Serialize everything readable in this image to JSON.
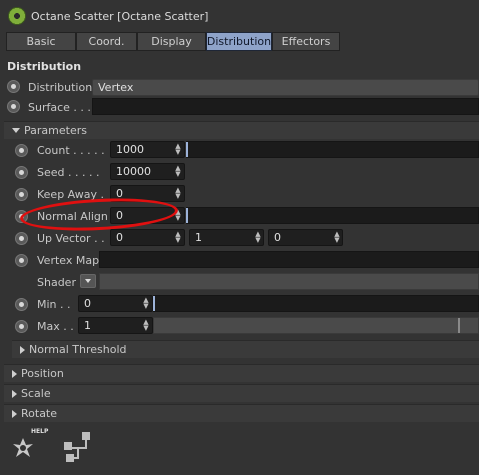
{
  "header": {
    "title": "Octane Scatter [Octane Scatter]",
    "icon": "octane-scatter-icon"
  },
  "tabs": [
    {
      "label": "Basic",
      "active": false
    },
    {
      "label": "Coord.",
      "active": false
    },
    {
      "label": "Display",
      "active": false
    },
    {
      "label": "Distribution",
      "active": true
    },
    {
      "label": "Effectors",
      "active": false
    }
  ],
  "section_title": "Distribution",
  "distribution": {
    "label": "Distribution",
    "value": "Vertex"
  },
  "surface": {
    "label": "Surface . . ."
  },
  "parameters_group": "Parameters",
  "params": {
    "count": {
      "label": "Count . . . . .",
      "value": "1000"
    },
    "seed": {
      "label": "Seed . . . . .",
      "value": "10000"
    },
    "keep_away": {
      "label": "Keep Away .",
      "value": "0"
    },
    "normal_align": {
      "label": "Normal Align",
      "value": "0"
    },
    "up_vector": {
      "label": "Up Vector . .",
      "x": "0",
      "y": "1",
      "z": "0"
    },
    "vertex_map": {
      "label": "Vertex Map"
    },
    "shader": {
      "label": "Shader"
    },
    "min": {
      "label": "Min . .",
      "value": "0"
    },
    "max": {
      "label": "Max . .",
      "value": "1"
    }
  },
  "normal_threshold_group": "Normal Threshold",
  "groups": [
    "Position",
    "Scale",
    "Rotate"
  ],
  "footer": {
    "help_label": "HELP",
    "icons": [
      "help-icon",
      "node-graph-icon"
    ]
  },
  "colors": {
    "accent_tab": "#8ea3c9",
    "annotation": "#e01010",
    "background": "#333333"
  }
}
